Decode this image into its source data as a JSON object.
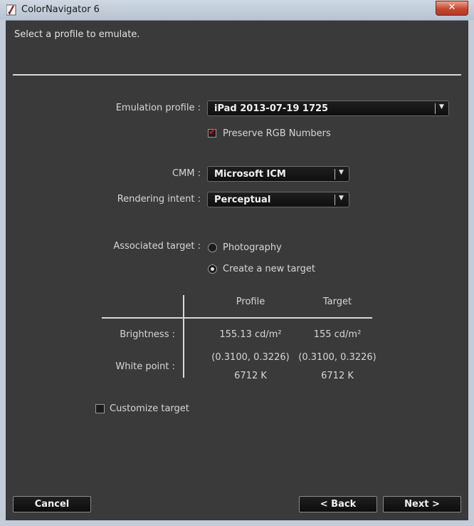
{
  "window": {
    "title": "ColorNavigator 6",
    "close_label": "✕"
  },
  "instruction": "Select a profile to emulate.",
  "emulation": {
    "label": "Emulation profile :",
    "value": "iPad 2013-07-19 1725",
    "preserve_label": "Preserve RGB Numbers",
    "preserve_checked": true
  },
  "cmm": {
    "label": "CMM :",
    "value": "Microsoft ICM"
  },
  "rendering": {
    "label": "Rendering intent :",
    "value": "Perceptual"
  },
  "target": {
    "label": "Associated target :",
    "options": [
      {
        "label": "Photography",
        "selected": false
      },
      {
        "label": "Create a new target",
        "selected": true
      }
    ]
  },
  "table": {
    "headers": {
      "profile": "Profile",
      "target": "Target"
    },
    "brightness": {
      "label": "Brightness :",
      "profile": "155.13 cd/m²",
      "target": "155 cd/m²"
    },
    "white_point": {
      "label": "White point :",
      "profile_xy": "(0.3100, 0.3226)",
      "target_xy": "(0.3100, 0.3226)",
      "profile_k": "6712 K",
      "target_k": "6712 K"
    }
  },
  "customize": {
    "label": "Customize target",
    "checked": false
  },
  "buttons": {
    "cancel": "Cancel",
    "back": "< Back",
    "next": "Next >"
  },
  "icons": {
    "app": "colornavigator-app-icon",
    "dropdown": "chevron-down-icon",
    "check": "checkmark-icon"
  },
  "colors": {
    "accent_check": "#d11a1a",
    "background": "#3a3a3a"
  }
}
